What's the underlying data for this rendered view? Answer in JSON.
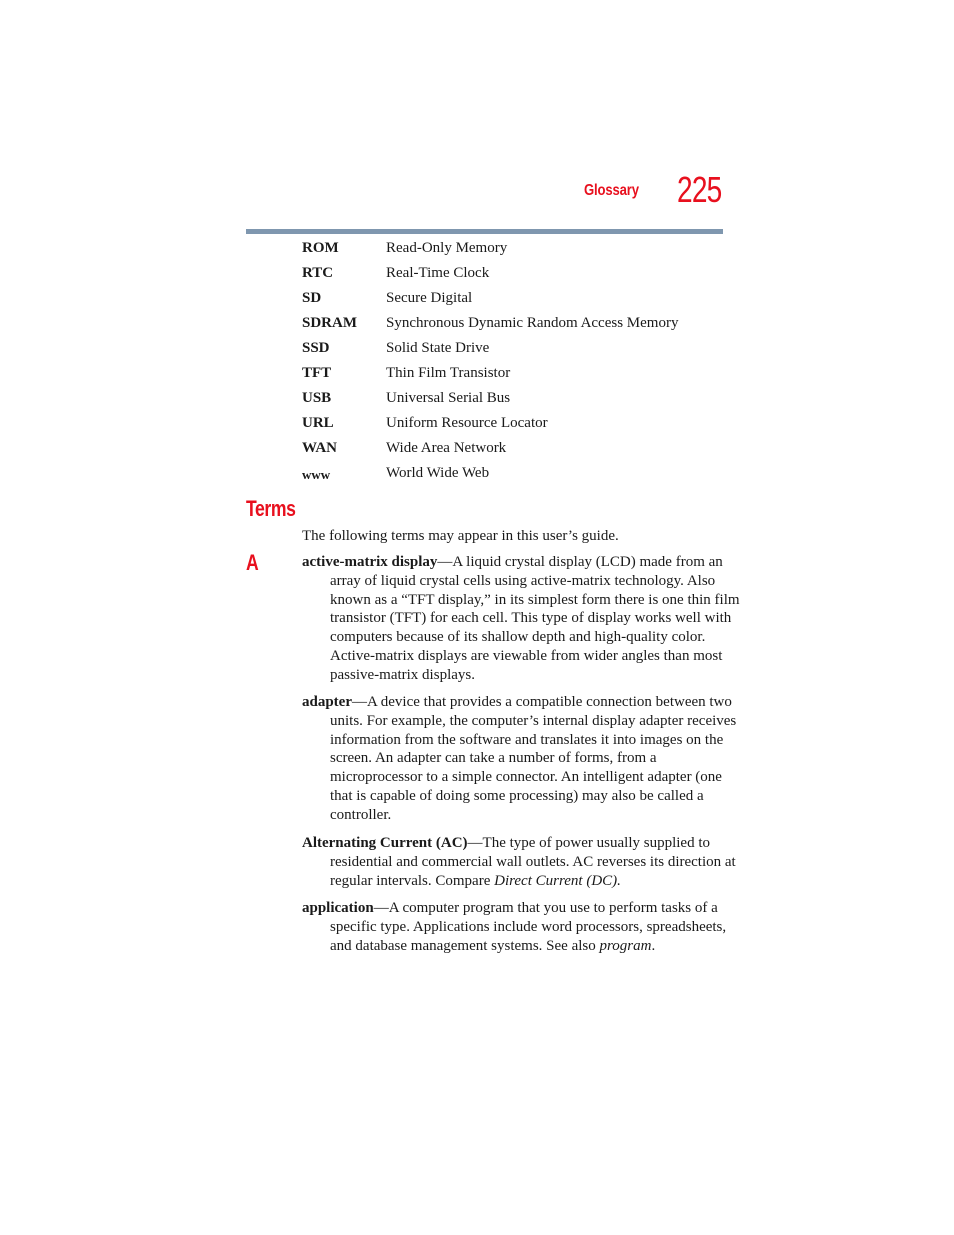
{
  "header": {
    "section": "Glossary",
    "page_number": "225",
    "accent_color": "#e8101e",
    "rule_color": "#7f97af"
  },
  "abbreviations": [
    {
      "term": "ROM",
      "definition": "Read-Only Memory"
    },
    {
      "term": "RTC",
      "definition": "Real-Time Clock"
    },
    {
      "term": "SD",
      "definition": "Secure Digital"
    },
    {
      "term": "SDRAM",
      "definition": "Synchronous Dynamic Random Access Memory"
    },
    {
      "term": "SSD",
      "definition": "Solid State Drive"
    },
    {
      "term": "TFT",
      "definition": "Thin Film Transistor"
    },
    {
      "term": "USB",
      "definition": "Universal Serial Bus"
    },
    {
      "term": "URL",
      "definition": "Uniform Resource Locator"
    },
    {
      "term": "WAN",
      "definition": "Wide Area Network"
    },
    {
      "term": "www",
      "definition": "World Wide Web"
    }
  ],
  "terms_section": {
    "heading": "Terms",
    "intro": "The following terms may appear in this user’s guide.",
    "letter": "A",
    "entries": [
      {
        "term": "active-matrix display",
        "lines": [
          "—A liquid crystal display (LCD) made from an",
          "array of liquid crystal cells using active-matrix technology. Also",
          "known as a “TFT display,” in its simplest form there is one thin film",
          "transistor (TFT) for each cell. This type of display works well with",
          "computers because of its shallow depth and high-quality color.",
          "Active-matrix displays are viewable from wider angles than most",
          "passive-matrix displays."
        ]
      },
      {
        "term": "adapter",
        "lines": [
          "—A device that provides a compatible connection between two",
          "units. For example, the computer’s internal display adapter receives",
          "information from the software and translates it into images on the",
          "screen. An adapter can take a number of forms, from a",
          "microprocessor to a simple connector. An intelligent adapter (one",
          "that is capable of doing some processing) may also be called a",
          "controller."
        ]
      },
      {
        "term": "Alternating Current (AC)",
        "lines": [
          "—The type of power usually supplied to",
          "residential and commercial wall outlets. AC reverses its direction at",
          "regular intervals. Compare "
        ],
        "italic_ref": "Direct Current (DC)",
        "tail": "."
      },
      {
        "term": "application",
        "lines": [
          "—A computer program that you use to perform tasks of a",
          "specific type. Applications include word processors, spreadsheets,",
          "and database management systems. See also "
        ],
        "italic_ref": "program",
        "tail": "."
      }
    ]
  }
}
